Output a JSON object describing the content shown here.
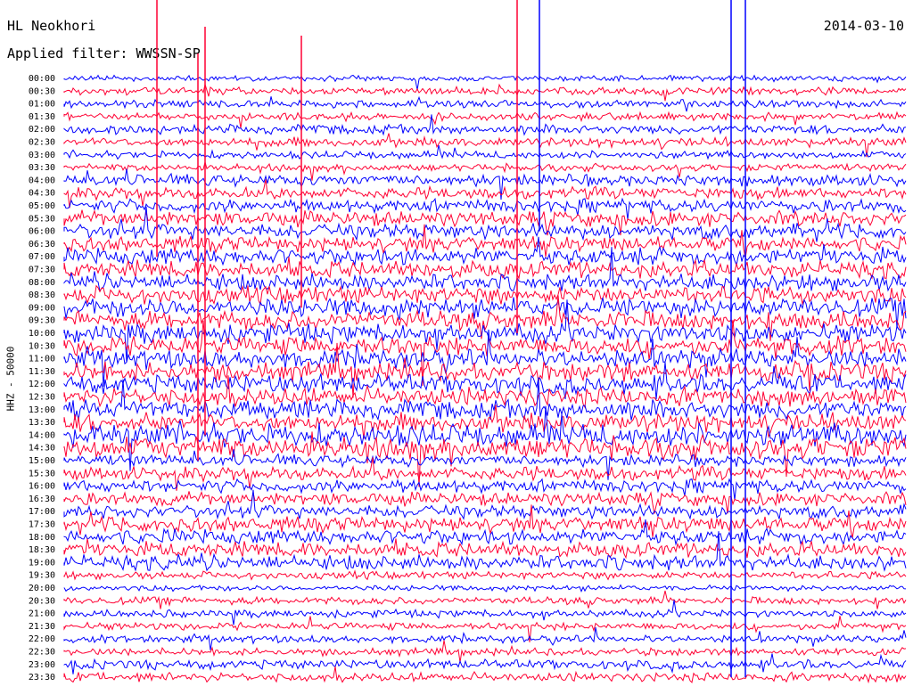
{
  "header": {
    "station": "HL Neokhori",
    "date": "2014-03-10",
    "filter": "Applied filter: WWSSN-SP"
  },
  "chart_data": {
    "type": "line",
    "title": "HL Neokhori",
    "subtitle": "Applied filter: WWSSN-SP",
    "ylabel": "HHZ - 50000",
    "row_labels": [
      "00:00",
      "00:30",
      "01:00",
      "01:30",
      "02:00",
      "02:30",
      "03:00",
      "03:30",
      "04:00",
      "04:30",
      "05:00",
      "05:30",
      "06:00",
      "06:30",
      "07:00",
      "07:30",
      "08:00",
      "08:30",
      "09:00",
      "09:30",
      "10:00",
      "10:30",
      "11:00",
      "11:30",
      "12:00",
      "12:30",
      "13:00",
      "13:30",
      "14:00",
      "14:30",
      "15:00",
      "15:30",
      "16:00",
      "16:30",
      "17:00",
      "17:30",
      "18:00",
      "18:30",
      "19:00",
      "19:30",
      "20:00",
      "20:30",
      "21:00",
      "21:30",
      "22:00",
      "22:30",
      "23:00",
      "23:30"
    ],
    "row_amplitude": [
      3,
      4,
      4,
      4,
      5,
      5,
      4,
      4,
      6,
      6,
      7,
      8,
      8,
      8,
      9,
      9,
      9,
      9,
      10,
      10,
      10,
      10,
      10,
      10,
      10,
      10,
      10,
      10,
      12,
      12,
      6,
      7,
      7,
      7,
      7,
      8,
      8,
      8,
      8,
      4,
      3,
      4,
      4,
      4,
      4,
      4,
      5,
      5
    ],
    "series_colors": [
      "#0000ff",
      "#ff0033"
    ],
    "grid": false
  }
}
